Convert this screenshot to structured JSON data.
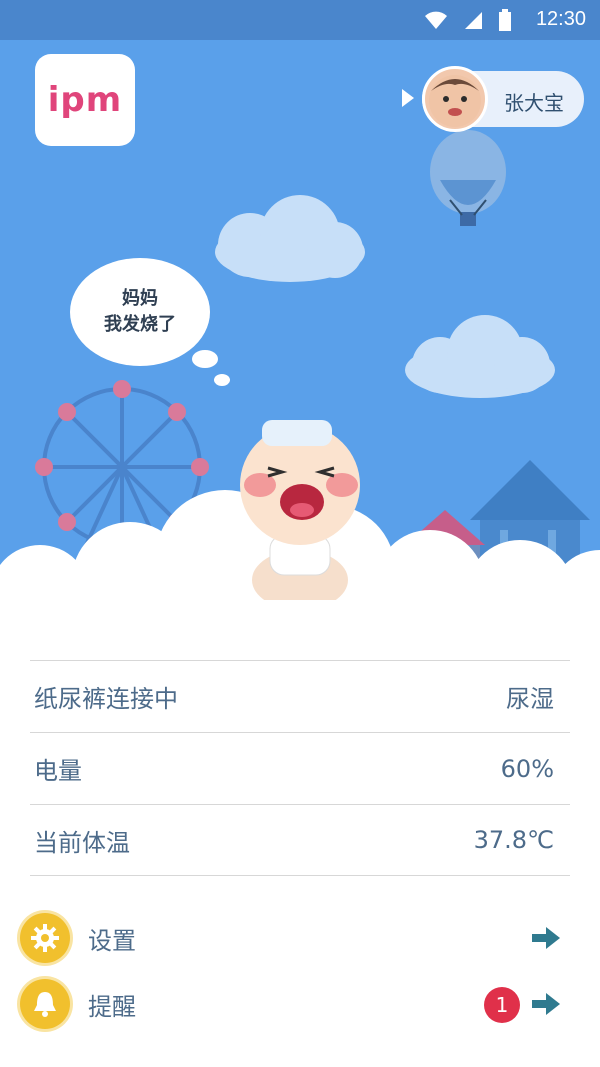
{
  "status_bar": {
    "time": "12:30"
  },
  "app": {
    "logo_text": "ipm"
  },
  "baby": {
    "name": "张大宝"
  },
  "speech_bubble": {
    "line1": "妈妈",
    "line2": "我发烧了"
  },
  "info_rows": [
    {
      "label": "纸尿裤连接中",
      "value": "尿湿"
    },
    {
      "label": "电量",
      "value": "60%"
    },
    {
      "label": "当前体温",
      "value": "37.8℃"
    }
  ],
  "menu": {
    "settings_label": "设置",
    "reminder_label": "提醒",
    "reminder_badge": "1"
  },
  "colors": {
    "status_bar": "#4a86cc",
    "sky": "#5aa0ea",
    "logo_pink": "#e0457b",
    "text": "#4d6b8a",
    "badge": "#e0304a",
    "icon_yellow": "#f1c02d",
    "arrow_teal": "#2f7a8f"
  },
  "icons": [
    "wifi-icon",
    "signal-icon",
    "battery-icon",
    "play-arrow-icon",
    "gear-icon",
    "bell-icon",
    "arrow-right-icon"
  ]
}
